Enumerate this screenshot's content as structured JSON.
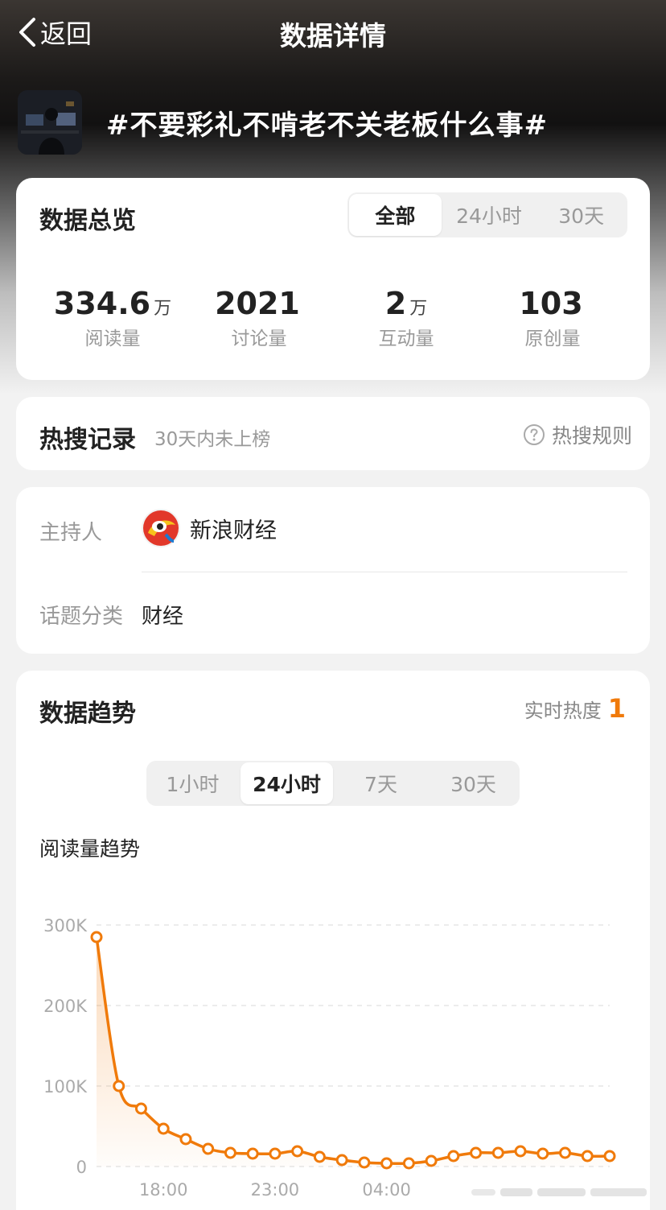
{
  "nav": {
    "back_label": "返回",
    "title": "数据详情"
  },
  "topic": {
    "title": "#不要彩礼不啃老不关老板什么事#"
  },
  "overview": {
    "title": "数据总览",
    "tabs": [
      "全部",
      "24小时",
      "30天"
    ],
    "active_tab": "全部",
    "stats": [
      {
        "value": "334.6",
        "unit": "万",
        "label": "阅读量"
      },
      {
        "value": "2021",
        "unit": "",
        "label": "讨论量"
      },
      {
        "value": "2",
        "unit": "万",
        "label": "互动量"
      },
      {
        "value": "103",
        "unit": "",
        "label": "原创量"
      }
    ]
  },
  "hot_search": {
    "title": "热搜记录",
    "status": "30天内未上榜",
    "rules_label": "热搜规则"
  },
  "info": {
    "host_label": "主持人",
    "host_name": "新浪财经",
    "category_label": "话题分类",
    "category_value": "财经"
  },
  "trend": {
    "title": "数据趋势",
    "realtime_label": "实时热度",
    "realtime_value": "1",
    "tabs": [
      "1小时",
      "24小时",
      "7天",
      "30天"
    ],
    "active_tab": "24小时",
    "chart_title": "阅读量趋势"
  },
  "colors": {
    "accent": "#f07a0a",
    "text": "#222222",
    "muted": "#999999"
  },
  "chart_data": {
    "type": "area",
    "ylabel": "",
    "xlabel": "",
    "y_ticks": [
      "0",
      "100K",
      "200K",
      "300K"
    ],
    "y_tick_values": [
      0,
      100000,
      200000,
      300000
    ],
    "x_ticks": [
      "18:00",
      "23:00",
      "04:00"
    ],
    "x_tick_indices": [
      3,
      8,
      13
    ],
    "ylim": [
      0,
      300000
    ],
    "grid": true,
    "series": [
      {
        "values": [
          285000,
          100000,
          72000,
          47000,
          34000,
          22000,
          17000,
          16000,
          16000,
          19000,
          12000,
          8000,
          5000,
          4000,
          4000,
          7000,
          13000,
          17000,
          17000,
          19000,
          16000,
          17000,
          13000,
          13000
        ]
      }
    ]
  }
}
